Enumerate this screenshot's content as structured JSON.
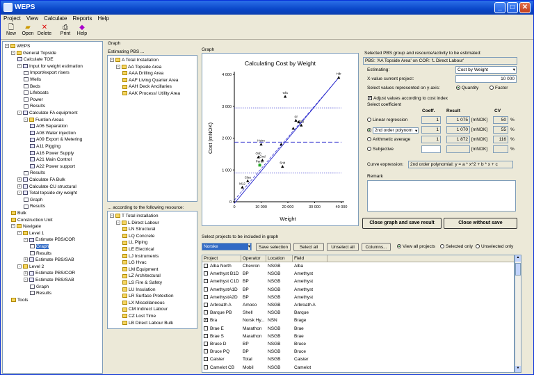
{
  "app": {
    "title": "WEPS"
  },
  "menu": [
    "Project",
    "View",
    "Calculate",
    "Reports",
    "Help"
  ],
  "toolbar": [
    "New",
    "Open",
    "Delete",
    "Print",
    "Help"
  ],
  "tree": [
    {
      "l": "WEPS",
      "d": 0,
      "i": "f",
      "e": "-"
    },
    {
      "l": "General Topside",
      "d": 1,
      "i": "f",
      "e": "-"
    },
    {
      "l": "Calculate TOE",
      "d": 2,
      "i": "c"
    },
    {
      "l": "Input for weight estimation",
      "d": 2,
      "i": "v",
      "e": "-"
    },
    {
      "l": "Import/export risers",
      "d": 3,
      "i": "d"
    },
    {
      "l": "Wells",
      "d": 3,
      "i": "d"
    },
    {
      "l": "Beds",
      "d": 3,
      "i": "d"
    },
    {
      "l": "Lifeboats",
      "d": 3,
      "i": "d"
    },
    {
      "l": "Power",
      "d": 3,
      "i": "d"
    },
    {
      "l": "Results",
      "d": 3,
      "i": "d"
    },
    {
      "l": "Calculate FA equipment",
      "d": 2,
      "i": "v",
      "e": "-"
    },
    {
      "l": "Funtion Areas",
      "d": 3,
      "i": "f",
      "e": "-"
    },
    {
      "l": "A06 Separation",
      "d": 4,
      "i": "v"
    },
    {
      "l": "A08 Water injection",
      "d": 4,
      "i": "v"
    },
    {
      "l": "A09 Export & Metering",
      "d": 4,
      "i": "v"
    },
    {
      "l": "A11 Pigging",
      "d": 4,
      "i": "v"
    },
    {
      "l": "A16 Power Supply",
      "d": 4,
      "i": "v"
    },
    {
      "l": "A21 Main Control",
      "d": 4,
      "i": "v"
    },
    {
      "l": "A22 Power support",
      "d": 4,
      "i": "v"
    },
    {
      "l": "Results",
      "d": 3,
      "i": "d"
    },
    {
      "l": "Calculate FA Bulk",
      "d": 2,
      "i": "v",
      "e": "+"
    },
    {
      "l": "Calculate CU structural",
      "d": 2,
      "i": "v",
      "e": "+"
    },
    {
      "l": "Total topside dry weight",
      "d": 2,
      "i": "v",
      "e": "-"
    },
    {
      "l": "Graph",
      "d": 3,
      "i": "d"
    },
    {
      "l": "Results",
      "d": 3,
      "i": "d"
    },
    {
      "l": "Bulk",
      "d": 1,
      "i": "f"
    },
    {
      "l": "Construction Unit",
      "d": 1,
      "i": "f"
    },
    {
      "l": "Navigate",
      "d": 1,
      "i": "f",
      "e": "-"
    },
    {
      "l": "Level 1",
      "d": 2,
      "i": "f",
      "e": "-"
    },
    {
      "l": "Estimate PBS/COR",
      "d": 3,
      "i": "v",
      "e": "-"
    },
    {
      "l": "Graph",
      "d": 4,
      "i": "d",
      "s": true
    },
    {
      "l": "Results",
      "d": 4,
      "i": "d"
    },
    {
      "l": "Estimate PBS/SAB",
      "d": 3,
      "i": "v",
      "e": "+"
    },
    {
      "l": "Level 2",
      "d": 2,
      "i": "f",
      "e": "-"
    },
    {
      "l": "Estimate PBS/COR",
      "d": 3,
      "i": "v",
      "e": "+"
    },
    {
      "l": "Estimate PBS/SAB",
      "d": 3,
      "i": "v",
      "e": "-"
    },
    {
      "l": "Graph",
      "d": 4,
      "i": "d"
    },
    {
      "l": "Results",
      "d": 4,
      "i": "d"
    },
    {
      "l": "Tools",
      "d": 1,
      "i": "f"
    }
  ],
  "graph_group": "Graph",
  "pbs_label": "Estimating PBS ...",
  "pbs_tree": [
    {
      "l": "A Total Installation",
      "d": 0,
      "e": "-"
    },
    {
      "l": "AA Topside Area",
      "d": 1,
      "e": "-"
    },
    {
      "l": "AAA Drilling Area",
      "d": 2
    },
    {
      "l": "AAF Living Quarter Area",
      "d": 2
    },
    {
      "l": "AAH Deck Ancillaries",
      "d": 2
    },
    {
      "l": "AAK Process/ Utility Area",
      "d": 2
    }
  ],
  "res_label": "... according to the following resource:",
  "res_tree": [
    {
      "l": "T Total installation",
      "d": 0,
      "e": "-"
    },
    {
      "l": "L Direct Labour",
      "d": 1,
      "e": "-"
    },
    {
      "l": "LN Structural",
      "d": 2
    },
    {
      "l": "LQ Concrete",
      "d": 2
    },
    {
      "l": "LL Piping",
      "d": 2
    },
    {
      "l": "LE Electrical",
      "d": 2
    },
    {
      "l": "LJ Instruments",
      "d": 2
    },
    {
      "l": "LG Hvac",
      "d": 2
    },
    {
      "l": "LM Equipment",
      "d": 2
    },
    {
      "l": "LZ Architectural",
      "d": 2
    },
    {
      "l": "LS Fire & Safety",
      "d": 2
    },
    {
      "l": "LU Insulation",
      "d": 2
    },
    {
      "l": "LR Surface Protection",
      "d": 2
    },
    {
      "l": "LX Miscellaneous",
      "d": 2
    },
    {
      "l": "CM Indirect Labour",
      "d": 2
    },
    {
      "l": "CZ Lost Time",
      "d": 2
    },
    {
      "l": "LB Direct Labour Bulk",
      "d": 2
    }
  ],
  "chart_group": "Graph",
  "chart_data": {
    "type": "scatter",
    "title": "Calculating Cost by Weight",
    "xlabel": "Weight",
    "ylabel": "Cost (mNOK)",
    "xlim": [
      0,
      40000
    ],
    "ylim": [
      0,
      4000
    ],
    "xticks": [
      "0",
      "10 000",
      "20 000",
      "30 000",
      "40 000"
    ],
    "yticks": [
      "0",
      "1 000",
      "2 000",
      "3 000",
      "4 000"
    ],
    "points": [
      {
        "x": 39000,
        "y": 3900,
        "label": "Hdr"
      },
      {
        "x": 19000,
        "y": 3300,
        "label": "Gfa"
      },
      {
        "x": 23000,
        "y": 2550,
        "label": "Sf"
      },
      {
        "x": 24000,
        "y": 2500,
        "label": ""
      },
      {
        "x": 25000,
        "y": 2400,
        "label": "Brg"
      },
      {
        "x": 22000,
        "y": 2300,
        "label": ""
      },
      {
        "x": 10000,
        "y": 1800,
        "label": "Heim"
      },
      {
        "x": 9000,
        "y": 1400,
        "label": "Osb"
      },
      {
        "x": 10500,
        "y": 1300,
        "label": "Gnd"
      },
      {
        "x": 17500,
        "y": 1800,
        "label": ""
      },
      {
        "x": 9500,
        "y": 1150,
        "label": "Persn"
      },
      {
        "x": 18000,
        "y": 1100,
        "label": "Snb"
      },
      {
        "x": 5000,
        "y": 650,
        "label": "Clsa"
      },
      {
        "x": 3000,
        "y": 450,
        "label": "M12"
      }
    ],
    "regression": [
      {
        "x": 0,
        "y": -50
      },
      {
        "x": 39000,
        "y": 3900
      }
    ],
    "mean_line": 1872,
    "mean_band": [
      900,
      2950
    ]
  },
  "sel_label": "Selected PBS group and resource/activity to be estimated:",
  "sel_value": "PBS: 'AA Topside Area' on COR: 'L Direct Labour'",
  "estimating_label": "Estimating:",
  "estimating_value": "Cost by Weight",
  "xval_label": "X-value current project:",
  "xval_value": "10 000",
  "yaxis_label": "Select values represented on y-axis:",
  "yopt": [
    "Quantity",
    "Factor"
  ],
  "adjust_label": "Adjust values according to cost index",
  "coef_label": "Select coefficient",
  "col_coeff": "Coeff.",
  "col_result": "Result",
  "col_cv": "CV",
  "methods": [
    {
      "name": "Linear regression",
      "coeff": "1",
      "result": "1 075",
      "unit": "[mNOK]",
      "cv": "50",
      "pct": "%"
    },
    {
      "name": "2nd order polynom",
      "coeff": "1",
      "result": "1 070",
      "unit": "[mNOK]",
      "cv": "55",
      "pct": "%"
    },
    {
      "name": "Arithmetic average",
      "coeff": "1",
      "result": "1 872",
      "unit": "[mNOK]",
      "cv": "116",
      "pct": "%"
    },
    {
      "name": "Subjective",
      "coeff": "",
      "result": "",
      "unit": "[mNOK]",
      "cv": "",
      "pct": "%"
    }
  ],
  "curve_label": "Curve expression:",
  "curve_value": "2nd order polynomial: y = a * x^2 + b * x + c",
  "remark_label": "Remark",
  "btn_close_save": "Close graph and save result",
  "btn_close_nosave": "Close without save",
  "proj_label": "Select projects to be included in graph",
  "proj_filter": "Norske",
  "btn_save_sel": "Save selection",
  "btn_select_all": "Select all",
  "btn_unselect_all": "Unselect all",
  "btn_columns": "Columns...",
  "view_opts": [
    "View all projects",
    "Selected only",
    "Unselected only"
  ],
  "cols": [
    "Project",
    "Operator",
    "Location",
    "Field"
  ],
  "rows": [
    [
      "Alba North",
      "Chevron",
      "NSGB",
      "Alba"
    ],
    [
      "Amethyst B1D",
      "BP",
      "NSGB",
      "Amethyst"
    ],
    [
      "Amethyst C1D",
      "BP",
      "NSGB",
      "Amethyst"
    ],
    [
      "AmethystA1D",
      "BP",
      "NSGB",
      "Amethyst"
    ],
    [
      "AmethystA2D",
      "BP",
      "NSGB",
      "Amethyst"
    ],
    [
      "Arbroath A",
      "Amoco",
      "NSGB",
      "Arbroath A"
    ],
    [
      "Barque PB",
      "Shell",
      "NSGB",
      "Barque"
    ],
    [
      "Bra",
      "Norsk Hy...",
      "NSN",
      "Brage"
    ],
    [
      "Brae E",
      "Marathon",
      "NSGB",
      "Brae"
    ],
    [
      "Brae S",
      "Marathon",
      "NSGB",
      "Brae"
    ],
    [
      "Bruce D",
      "BP",
      "NSGB",
      "Bruce"
    ],
    [
      "Bruce PQ",
      "BP",
      "NSGB",
      "Bruce"
    ],
    [
      "Caister",
      "Total",
      "NSGB",
      "Caister"
    ],
    [
      "Camelot CB",
      "Mobil",
      "NSGB",
      "Camelot"
    ]
  ],
  "checked_row": 7
}
